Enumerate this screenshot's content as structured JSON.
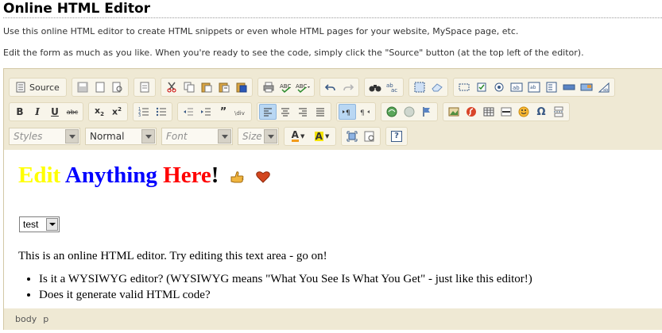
{
  "page": {
    "title": "Online HTML Editor",
    "intro_1": "Use this online HTML editor to create HTML snippets or even whole HTML pages for your website, MySpace page, etc.",
    "intro_2": "Edit the form as much as you like. When you're ready to see the code, simply click the \"Source\" button (at the top left of the editor)."
  },
  "toolbar": {
    "source_label": "Source",
    "font_style_placeholder": "Styles",
    "format_value": "Normal",
    "font_placeholder": "Font",
    "size_placeholder": "Size",
    "bold_glyph": "B",
    "italic_glyph": "I",
    "underline_glyph": "U",
    "strike_glyph": "abc",
    "subscript_glyph": "x2",
    "superscript_glyph": "x2",
    "text_color_glyph": "A",
    "bg_color_glyph": "A",
    "help_glyph": "?"
  },
  "content": {
    "headline_word1": "Edit",
    "headline_word2": "Anything",
    "headline_word3": "Here",
    "headline_bang": "!",
    "select_value": "test",
    "paragraph": "This is an online HTML editor. Try editing this text area - go on!",
    "bullets": [
      "Is it a WYSIWYG editor? (WYSIWYG means \"What You See Is What You Get\" - just like this editor!)",
      "Does it generate valid HTML code?"
    ]
  },
  "statusbar": {
    "path_items": [
      "body",
      "p"
    ]
  },
  "colors": {
    "headline_word1": "#ffff00",
    "headline_word2": "#0000ff",
    "headline_word3": "#ff0000",
    "toolbar_bg": "#efe9d4",
    "active_button": "#b9d7f3"
  }
}
